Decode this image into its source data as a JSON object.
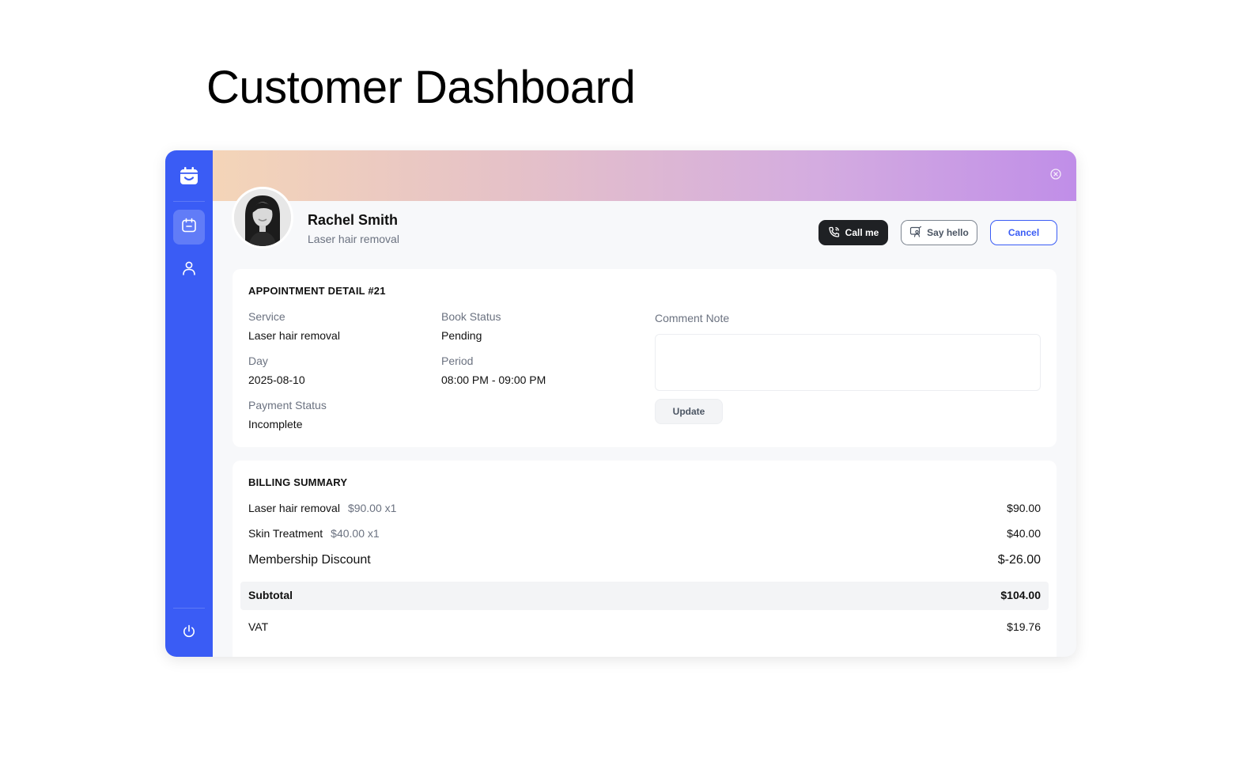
{
  "page": {
    "title": "Customer Dashboard"
  },
  "colors": {
    "accent": "#3a5cf5",
    "dark_button": "#1f2124",
    "muted_text": "#6b7280"
  },
  "sidebar": {
    "logo_icon": "calendar-smile-icon",
    "items": [
      {
        "icon": "calendar-icon",
        "active": true
      },
      {
        "icon": "user-icon",
        "active": false
      }
    ],
    "footer_icon": "power-icon"
  },
  "customer": {
    "name": "Rachel Smith",
    "service": "Laser hair removal"
  },
  "actions": {
    "call_label": "Call me",
    "hello_label": "Say hello",
    "cancel_label": "Cancel"
  },
  "appointment": {
    "title": "APPOINTMENT DETAIL #21",
    "service_label": "Service",
    "service_value": "Laser hair removal",
    "day_label": "Day",
    "day_value": "2025-08-10",
    "payment_label": "Payment Status",
    "payment_value": "Incomplete",
    "book_status_label": "Book Status",
    "book_status_value": "Pending",
    "period_label": "Period",
    "period_value": "08:00 PM - 09:00 PM",
    "comment_label": "Comment Note",
    "comment_value": "",
    "update_label": "Update"
  },
  "billing": {
    "title": "BILLING SUMMARY",
    "lines": [
      {
        "name": "Laser hair removal",
        "unit": "$90.00 x1",
        "amount": "$90.00"
      },
      {
        "name": "Skin Treatment",
        "unit": "$40.00 x1",
        "amount": "$40.00"
      }
    ],
    "discount_label": "Membership Discount",
    "discount_amount": "$-26.00",
    "subtotal_label": "Subtotal",
    "subtotal_amount": "$104.00",
    "vat_label": "VAT",
    "vat_amount": "$19.76"
  }
}
